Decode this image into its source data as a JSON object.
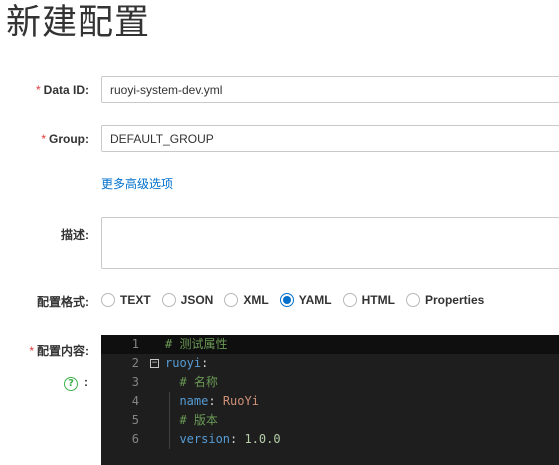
{
  "page": {
    "title": "新建配置"
  },
  "form": {
    "required_mark": "*",
    "data_id": {
      "label": "Data ID:",
      "value": "ruoyi-system-dev.yml"
    },
    "group": {
      "label": "Group:",
      "value": "DEFAULT_GROUP"
    },
    "advanced_link": "更多高级选项",
    "description": {
      "label": "描述:",
      "value": ""
    },
    "format": {
      "label": "配置格式:",
      "selected": "YAML",
      "options": [
        {
          "label": "TEXT",
          "checked": false
        },
        {
          "label": "JSON",
          "checked": false
        },
        {
          "label": "XML",
          "checked": false
        },
        {
          "label": "YAML",
          "checked": true
        },
        {
          "label": "HTML",
          "checked": false
        },
        {
          "label": "Properties",
          "checked": false
        }
      ]
    },
    "content": {
      "label": "配置内容:",
      "help_icon": "question-circle-icon",
      "help_symbol": "?",
      "help_colon": ":"
    }
  },
  "editor": {
    "fold_icon": "fold-minus-icon",
    "fold_symbol": "−",
    "lines": [
      {
        "num": "1",
        "indent": "",
        "comment": "# 测试属性",
        "key": "",
        "colon": "",
        "value": ""
      },
      {
        "num": "2",
        "indent": "",
        "comment": "",
        "key": "ruoyi",
        "colon": ":",
        "value": ""
      },
      {
        "num": "3",
        "indent": "  ",
        "comment": "# 名称",
        "key": "",
        "colon": "",
        "value": ""
      },
      {
        "num": "4",
        "indent": "  ",
        "comment": "",
        "key": "name",
        "colon": ": ",
        "value": "RuoYi"
      },
      {
        "num": "5",
        "indent": "  ",
        "comment": "# 版本",
        "key": "",
        "colon": "",
        "value": ""
      },
      {
        "num": "6",
        "indent": "  ",
        "comment": "",
        "key": "version",
        "colon": ": ",
        "value": "1.0.0"
      }
    ]
  },
  "colors": {
    "accent": "#0070cc",
    "required": "#e4393c",
    "help": "#3fb04a",
    "editor_bg": "#1e1e1e"
  }
}
